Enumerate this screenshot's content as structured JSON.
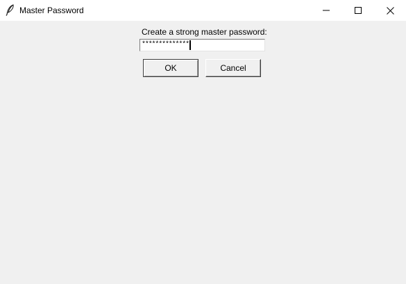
{
  "window": {
    "title": "Master Password",
    "icon": "feather-icon",
    "controls": {
      "minimize_icon": "minimize-icon",
      "maximize_icon": "maximize-icon",
      "close_icon": "close-icon"
    }
  },
  "dialog": {
    "prompt": "Create a strong master password:",
    "password_value": "**************",
    "ok_label": "OK",
    "cancel_label": "Cancel"
  },
  "colors": {
    "titlebar_bg": "#ffffff",
    "window_bg": "#f0f0f0",
    "input_bg": "#ffffff"
  }
}
